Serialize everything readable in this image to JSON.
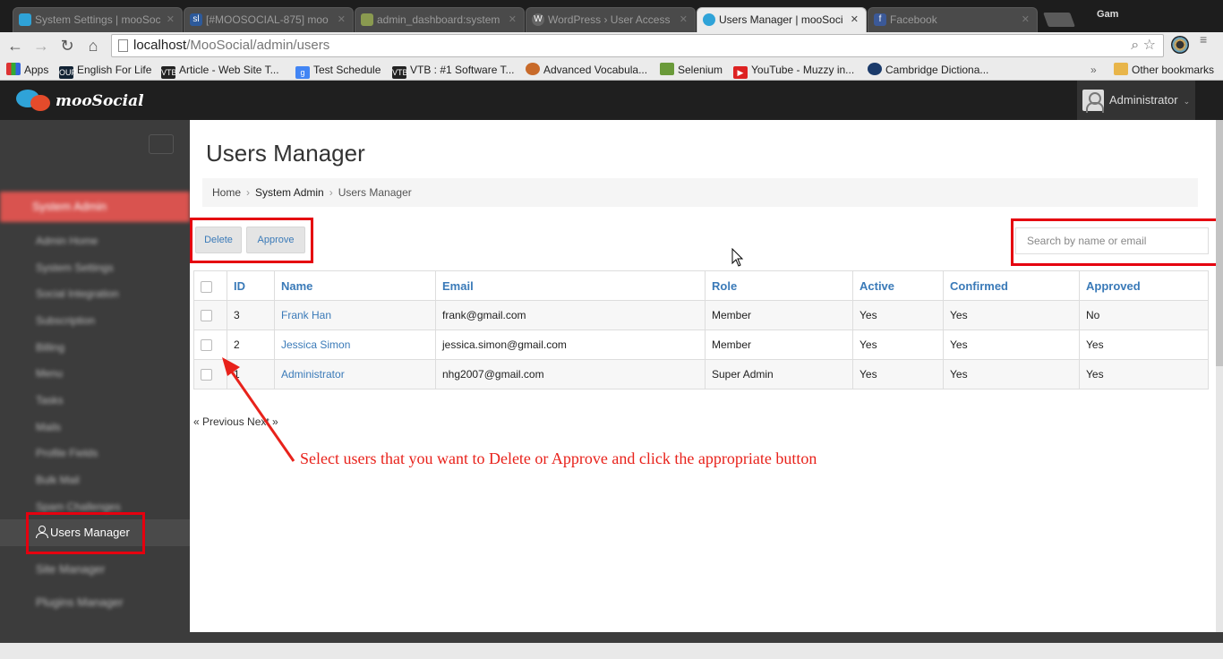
{
  "browser": {
    "tabs": [
      {
        "title": "System Settings | mooSoc",
        "active": false
      },
      {
        "title": "[#MOOSOCIAL-875] moo",
        "active": false
      },
      {
        "title": "admin_dashboard:system",
        "active": false
      },
      {
        "title": "WordPress › User Access",
        "active": false
      },
      {
        "title": "Users Manager | mooSoci",
        "active": true
      },
      {
        "title": "Facebook",
        "active": false
      }
    ],
    "profile": "Gam",
    "url_host": "localhost",
    "url_path": "/MooSocial/admin/users",
    "bookmarks": [
      {
        "label": "Apps",
        "icon": "apps-icon"
      },
      {
        "label": "English For Life",
        "icon": "oup-icon"
      },
      {
        "label": "Article - Web Site T...",
        "icon": "vtb-icon"
      },
      {
        "label": "Test Schedule",
        "icon": "google-icon"
      },
      {
        "label": "VTB : #1 Software T...",
        "icon": "vtb-icon"
      },
      {
        "label": "Advanced Vocabula...",
        "icon": "vocab-icon"
      },
      {
        "label": "Selenium",
        "icon": "selenium-icon"
      },
      {
        "label": "YouTube - Muzzy in...",
        "icon": "youtube-icon"
      },
      {
        "label": "Cambridge Dictiona...",
        "icon": "cambridge-icon"
      }
    ],
    "bookmarks_overflow": "»",
    "other_bookmarks": "Other bookmarks"
  },
  "header": {
    "brand": "mooSocial",
    "user": "Administrator"
  },
  "sidebar": {
    "section": "System Admin",
    "items": [
      "Admin Home",
      "System Settings",
      "Social Integration",
      "Subscription",
      "Billing",
      "Menu",
      "Tasks",
      "Mails",
      "Profile Fields",
      "Bulk Mail",
      "Spam Challenges",
      "Users Manager"
    ],
    "groups": [
      "Site Manager",
      "Plugins Manager"
    ]
  },
  "main": {
    "title": "Users Manager",
    "breadcrumb": [
      "Home",
      "System Admin",
      "Users Manager"
    ],
    "buttons": {
      "delete": "Delete",
      "approve": "Approve"
    },
    "search_placeholder": "Search by name or email",
    "columns": [
      "ID",
      "Name",
      "Email",
      "Role",
      "Active",
      "Confirmed",
      "Approved"
    ],
    "rows": [
      {
        "id": "3",
        "name": "Frank Han",
        "email": "frank@gmail.com",
        "role": "Member",
        "active": "Yes",
        "confirmed": "Yes",
        "approved": "No"
      },
      {
        "id": "2",
        "name": "Jessica Simon",
        "email": "jessica.simon@gmail.com",
        "role": "Member",
        "active": "Yes",
        "confirmed": "Yes",
        "approved": "Yes"
      },
      {
        "id": "1",
        "name": "Administrator",
        "email": "nhg2007@gmail.com",
        "role": "Super Admin",
        "active": "Yes",
        "confirmed": "Yes",
        "approved": "Yes"
      }
    ],
    "pager": "« Previous Next »",
    "annotation": "Select users that you want to Delete or Approve and click the appropriate button"
  },
  "colors": {
    "accent": "#3a7ab8",
    "annotation": "#e8221b",
    "sidebar": "#3c3c3c",
    "active_menu": "#d9534f"
  }
}
